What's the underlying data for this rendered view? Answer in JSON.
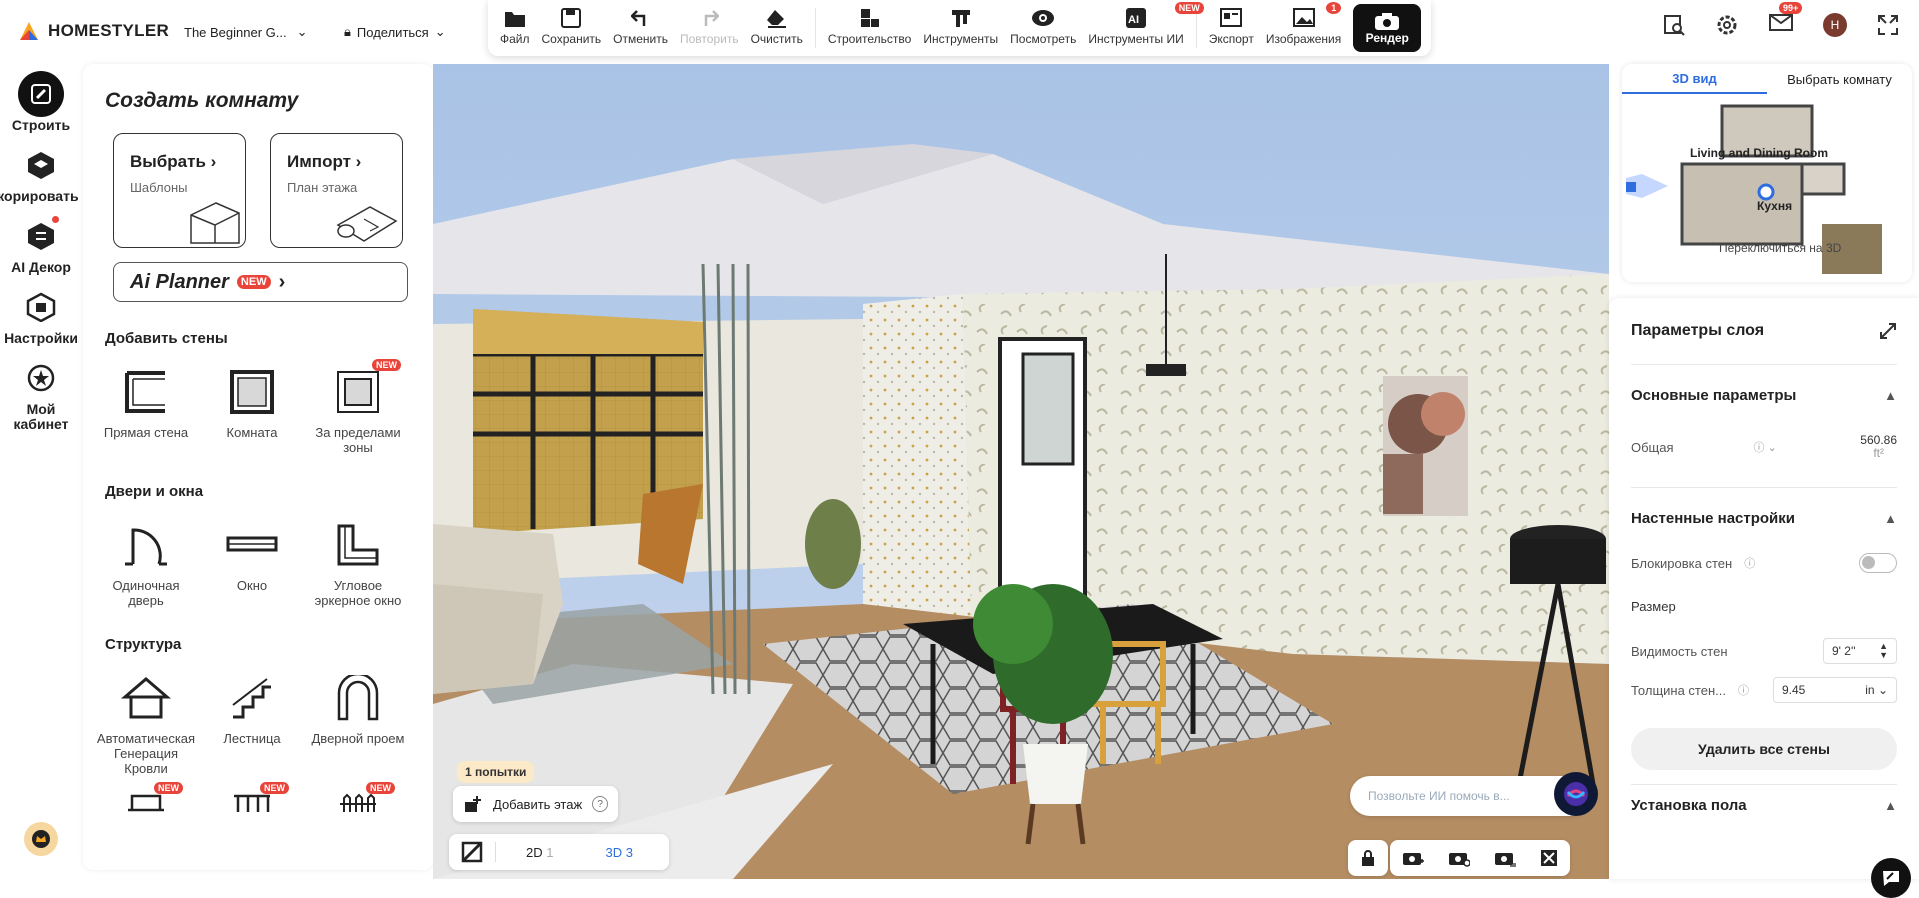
{
  "app": {
    "logo_text": "HOMESTYLER",
    "project_name": "The Beginner G...",
    "share_label": "Поделиться",
    "avatar_initial": "H",
    "mail_badge": "99+"
  },
  "toolbar": {
    "file": "Файл",
    "save": "Сохранить",
    "undo": "Отменить",
    "redo": "Повторить",
    "clear": "Очистить",
    "build": "Строительство",
    "tools": "Инструменты",
    "view": "Посмотреть",
    "ai_tools": "Инструменты ИИ",
    "ai_badge": "NEW",
    "export": "Экспорт",
    "images": "Изображения",
    "images_badge": "1",
    "render": "Рендер"
  },
  "leftnav": {
    "build": "Строить",
    "decorate": "екорировать",
    "ai_decor": "AI Декор",
    "settings": "Настройки",
    "cabinet_1": "Мой",
    "cabinet_2": "кабинет"
  },
  "panel": {
    "title": "Создать комнату",
    "choose_title": "Выбрать",
    "choose_sub": "Шаблоны",
    "import_title": "Импорт",
    "import_sub": "План этажа",
    "ai_planner": "Ai Planner",
    "ai_planner_badge": "NEW",
    "walls_header": "Добавить стены",
    "wall_items": [
      "Прямая стена",
      "Комната",
      "За пределами зоны"
    ],
    "new_badge": "NEW",
    "doors_header": "Двери и окна",
    "door_items": [
      "Одиночная дверь",
      "Окно",
      "Угловое эркерное окно"
    ],
    "structure_header": "Структура",
    "structure_items": [
      "Автоматическая Генерация Кровли",
      "Лестница",
      "Дверной проем"
    ]
  },
  "scene": {
    "attempts": "1 попытки",
    "add_floor": "Добавить этаж",
    "view2d": "2D",
    "view2d_count": "1",
    "view3d": "3D",
    "view3d_count": "3",
    "ai_placeholder": "Позвольте ИИ помочь в..."
  },
  "minimap": {
    "tab_3d": "3D вид",
    "tab_room": "Выбрать комнату",
    "room_label_1": "Living and Dining Room",
    "room_label_2": "Кухня",
    "switch_label": "Переключиться на 3D"
  },
  "layer": {
    "title": "Параметры слоя",
    "basic_header": "Основные параметры",
    "total_label": "Общая",
    "total_value": "560.86",
    "total_unit": "ft²",
    "wall_header": "Настенные настройки",
    "lock_label": "Блокировка стен",
    "size_label": "Размер",
    "visibility_label": "Видимость стен",
    "visibility_value": "9' 2''",
    "thickness_label": "Толщина стен...",
    "thickness_value": "9.45",
    "thickness_unit": "in",
    "delete_all": "Удалить все стены",
    "floor_header": "Установка пола"
  }
}
